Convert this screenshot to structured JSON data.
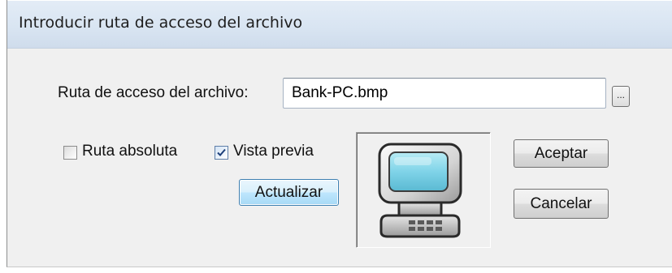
{
  "dialog": {
    "title": "Introducir ruta de acceso del archivo"
  },
  "path": {
    "label": "Ruta de acceso del archivo:",
    "value": "Bank-PC.bmp",
    "browse_label": "..."
  },
  "options": {
    "absolute_path": {
      "label": "Ruta absoluta",
      "checked": false
    },
    "preview": {
      "label": "Vista previa",
      "checked": true
    }
  },
  "buttons": {
    "refresh": "Actualizar",
    "ok": "Aceptar",
    "cancel": "Cancelar"
  },
  "preview_image": {
    "icon": "computer-icon"
  },
  "colors": {
    "titlebar": "#dce7f3",
    "dialog_bg": "#f0f0f0",
    "focus_button": "#bee6fd",
    "screen": "#7fd3e8"
  }
}
